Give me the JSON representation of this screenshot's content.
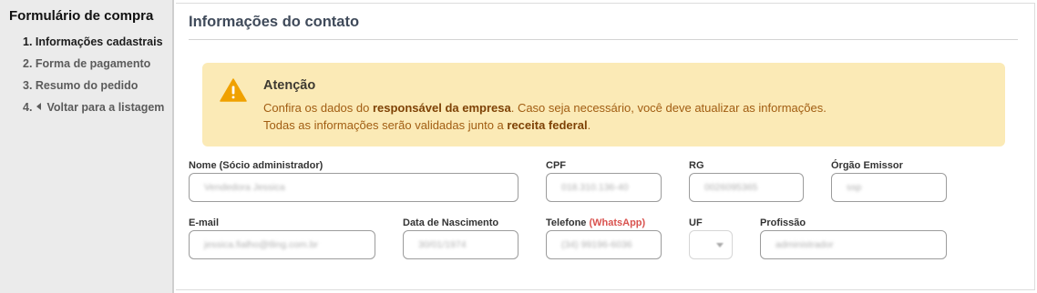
{
  "sidebar": {
    "title": "Formulário de compra",
    "items": [
      {
        "label": "1. Informações cadastrais",
        "active": true
      },
      {
        "label": "2. Forma de pagamento",
        "active": false
      },
      {
        "label": "3. Resumo do pedido",
        "active": false
      },
      {
        "label_prefix": "4.",
        "label": "Voltar para a listagem",
        "active": false
      }
    ]
  },
  "main": {
    "title": "Informações do contato",
    "alert": {
      "icon": "warning-icon",
      "heading": "Atenção",
      "line1_pre": "Confira os dados do ",
      "line1_bold": "responsável da empresa",
      "line1_post": ". Caso seja necessário, você deve atualizar as informações.",
      "line2_pre": "Todas as informações serão validadas junto a ",
      "line2_bold": "receita federal",
      "line2_post": "."
    },
    "form": {
      "nome": {
        "label": "Nome (Sócio administrador)",
        "value": "Vendedora Jessica"
      },
      "cpf": {
        "label": "CPF",
        "value": "018.310.136-40"
      },
      "rg": {
        "label": "RG",
        "value": "0026095365"
      },
      "orgao": {
        "label": "Órgão Emissor",
        "value": "ssp"
      },
      "email": {
        "label": "E-mail",
        "value": "jessica.fialho@tling.com.br"
      },
      "nascimento": {
        "label": "Data de Nascimento",
        "value": "30/01/1974"
      },
      "telefone": {
        "label": "Telefone",
        "label_suffix": "(WhatsApp)",
        "value": "(34) 99196-6036"
      },
      "uf": {
        "label": "UF",
        "value": ""
      },
      "profissao": {
        "label": "Profissão",
        "value": "administrador"
      }
    }
  },
  "colors": {
    "alert_bg": "#fbeab6",
    "alert_text": "#a15d12",
    "warning_icon": "#f0a100",
    "whatsapp_label": "#d9534f",
    "sidebar_bg": "#ebebeb"
  }
}
